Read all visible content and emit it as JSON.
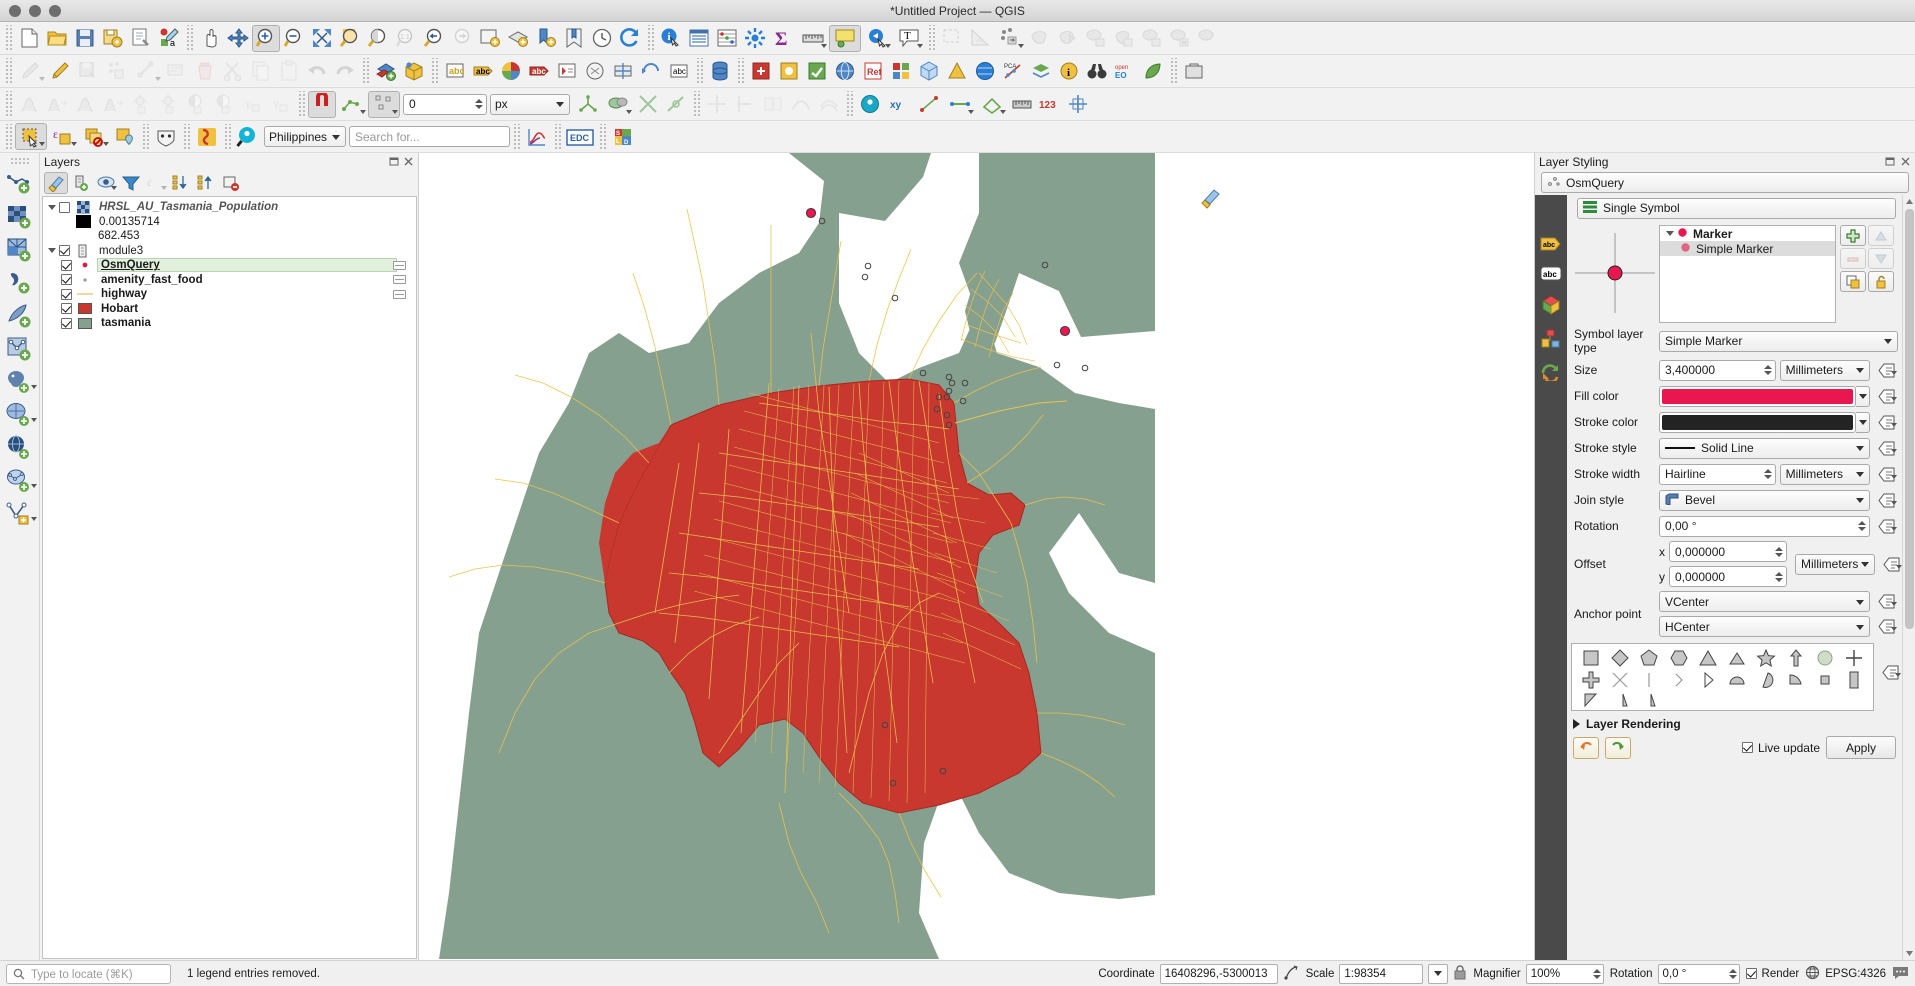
{
  "window": {
    "title": "*Untitled Project — QGIS"
  },
  "toolbar_row3": {
    "snap_value": "0",
    "snap_units": "px"
  },
  "toolbar_row4": {
    "region_combo": "Philippines",
    "search_placeholder": "Search for...",
    "edc_label": "EDC"
  },
  "layers_panel": {
    "title": "Layers",
    "tree": [
      {
        "name": "HRSL_AU_Tasmania_Population",
        "style": "italic",
        "checked": false,
        "indent": 0,
        "twisty": true,
        "icon": "raster-icon",
        "has_legend_badge": false
      },
      {
        "name": "0.00135714",
        "style": "plain",
        "checked": null,
        "indent": 1,
        "twisty": false,
        "icon": "black-swatch",
        "has_legend_badge": false
      },
      {
        "name": "682.453",
        "style": "plain",
        "checked": null,
        "indent": 1,
        "twisty": false,
        "icon": "none",
        "has_legend_badge": false
      },
      {
        "name": "module3",
        "style": "plain",
        "checked": true,
        "indent": 0,
        "twisty": true,
        "icon": "group-icon",
        "has_legend_badge": false
      },
      {
        "name": "OsmQuery",
        "style": "selected",
        "checked": true,
        "indent": 1,
        "twisty": false,
        "icon": "point-red",
        "has_legend_badge": true
      },
      {
        "name": "amenity_fast_food",
        "style": "bold",
        "checked": true,
        "indent": 1,
        "twisty": false,
        "icon": "point-grey",
        "has_legend_badge": true
      },
      {
        "name": "highway",
        "style": "bold",
        "checked": true,
        "indent": 1,
        "twisty": false,
        "icon": "line-yellow",
        "has_legend_badge": true
      },
      {
        "name": "Hobart",
        "style": "bold",
        "checked": true,
        "indent": 1,
        "twisty": false,
        "icon": "poly-red",
        "has_legend_badge": false
      },
      {
        "name": "tasmania",
        "style": "bold",
        "checked": true,
        "indent": 1,
        "twisty": false,
        "icon": "poly-green",
        "has_legend_badge": false
      }
    ]
  },
  "styling_panel": {
    "title": "Layer Styling",
    "layer_name": "OsmQuery",
    "renderer": "Single Symbol",
    "symbol_tree": [
      {
        "label": "Marker",
        "child": false
      },
      {
        "label": "Simple Marker",
        "child": true
      }
    ],
    "fields": {
      "symbol_layer_type_label": "Symbol layer type",
      "symbol_layer_type_value": "Simple Marker",
      "size_label": "Size",
      "size_value": "3,400000",
      "size_units": "Millimeters",
      "fill_color_label": "Fill color",
      "fill_color_value": "#e8174f",
      "stroke_color_label": "Stroke color",
      "stroke_color_value": "#232323",
      "stroke_style_label": "Stroke style",
      "stroke_style_value": "Solid Line",
      "stroke_width_label": "Stroke width",
      "stroke_width_value": "Hairline",
      "stroke_width_units": "Millimeters",
      "join_style_label": "Join style",
      "join_style_value": "Bevel",
      "rotation_label": "Rotation",
      "rotation_value": "0,00 °",
      "offset_label": "Offset",
      "offset_x_prefix": "x",
      "offset_x_value": "0,000000",
      "offset_y_prefix": "y",
      "offset_y_value": "0,000000",
      "offset_units": "Millimeters",
      "anchor_point_label": "Anchor point",
      "anchor_v_value": "VCenter",
      "anchor_h_value": "HCenter"
    },
    "layer_rendering_label": "Layer Rendering",
    "live_update_label": "Live update",
    "live_update_checked": true,
    "apply_label": "Apply"
  },
  "status_bar": {
    "locator_placeholder": "Type to locate (⌘K)",
    "message": "1 legend entries removed.",
    "coordinate_label": "Coordinate",
    "coordinate_value": "16408296,-5300013",
    "scale_label": "Scale",
    "scale_value": "1:98354",
    "magnifier_label": "Magnifier",
    "magnifier_value": "100%",
    "rotation_label": "Rotation",
    "rotation_value": "0,0 °",
    "render_label": "Render",
    "render_checked": true,
    "crs_label": "EPSG:4326"
  },
  "colors": {
    "map_land": "#86a090",
    "map_water": "#ffffff",
    "hobart_fill": "#c8382f",
    "highway": "#e8c34a",
    "marker_fill": "#e8174f",
    "accent_blue": "#3465a4"
  }
}
